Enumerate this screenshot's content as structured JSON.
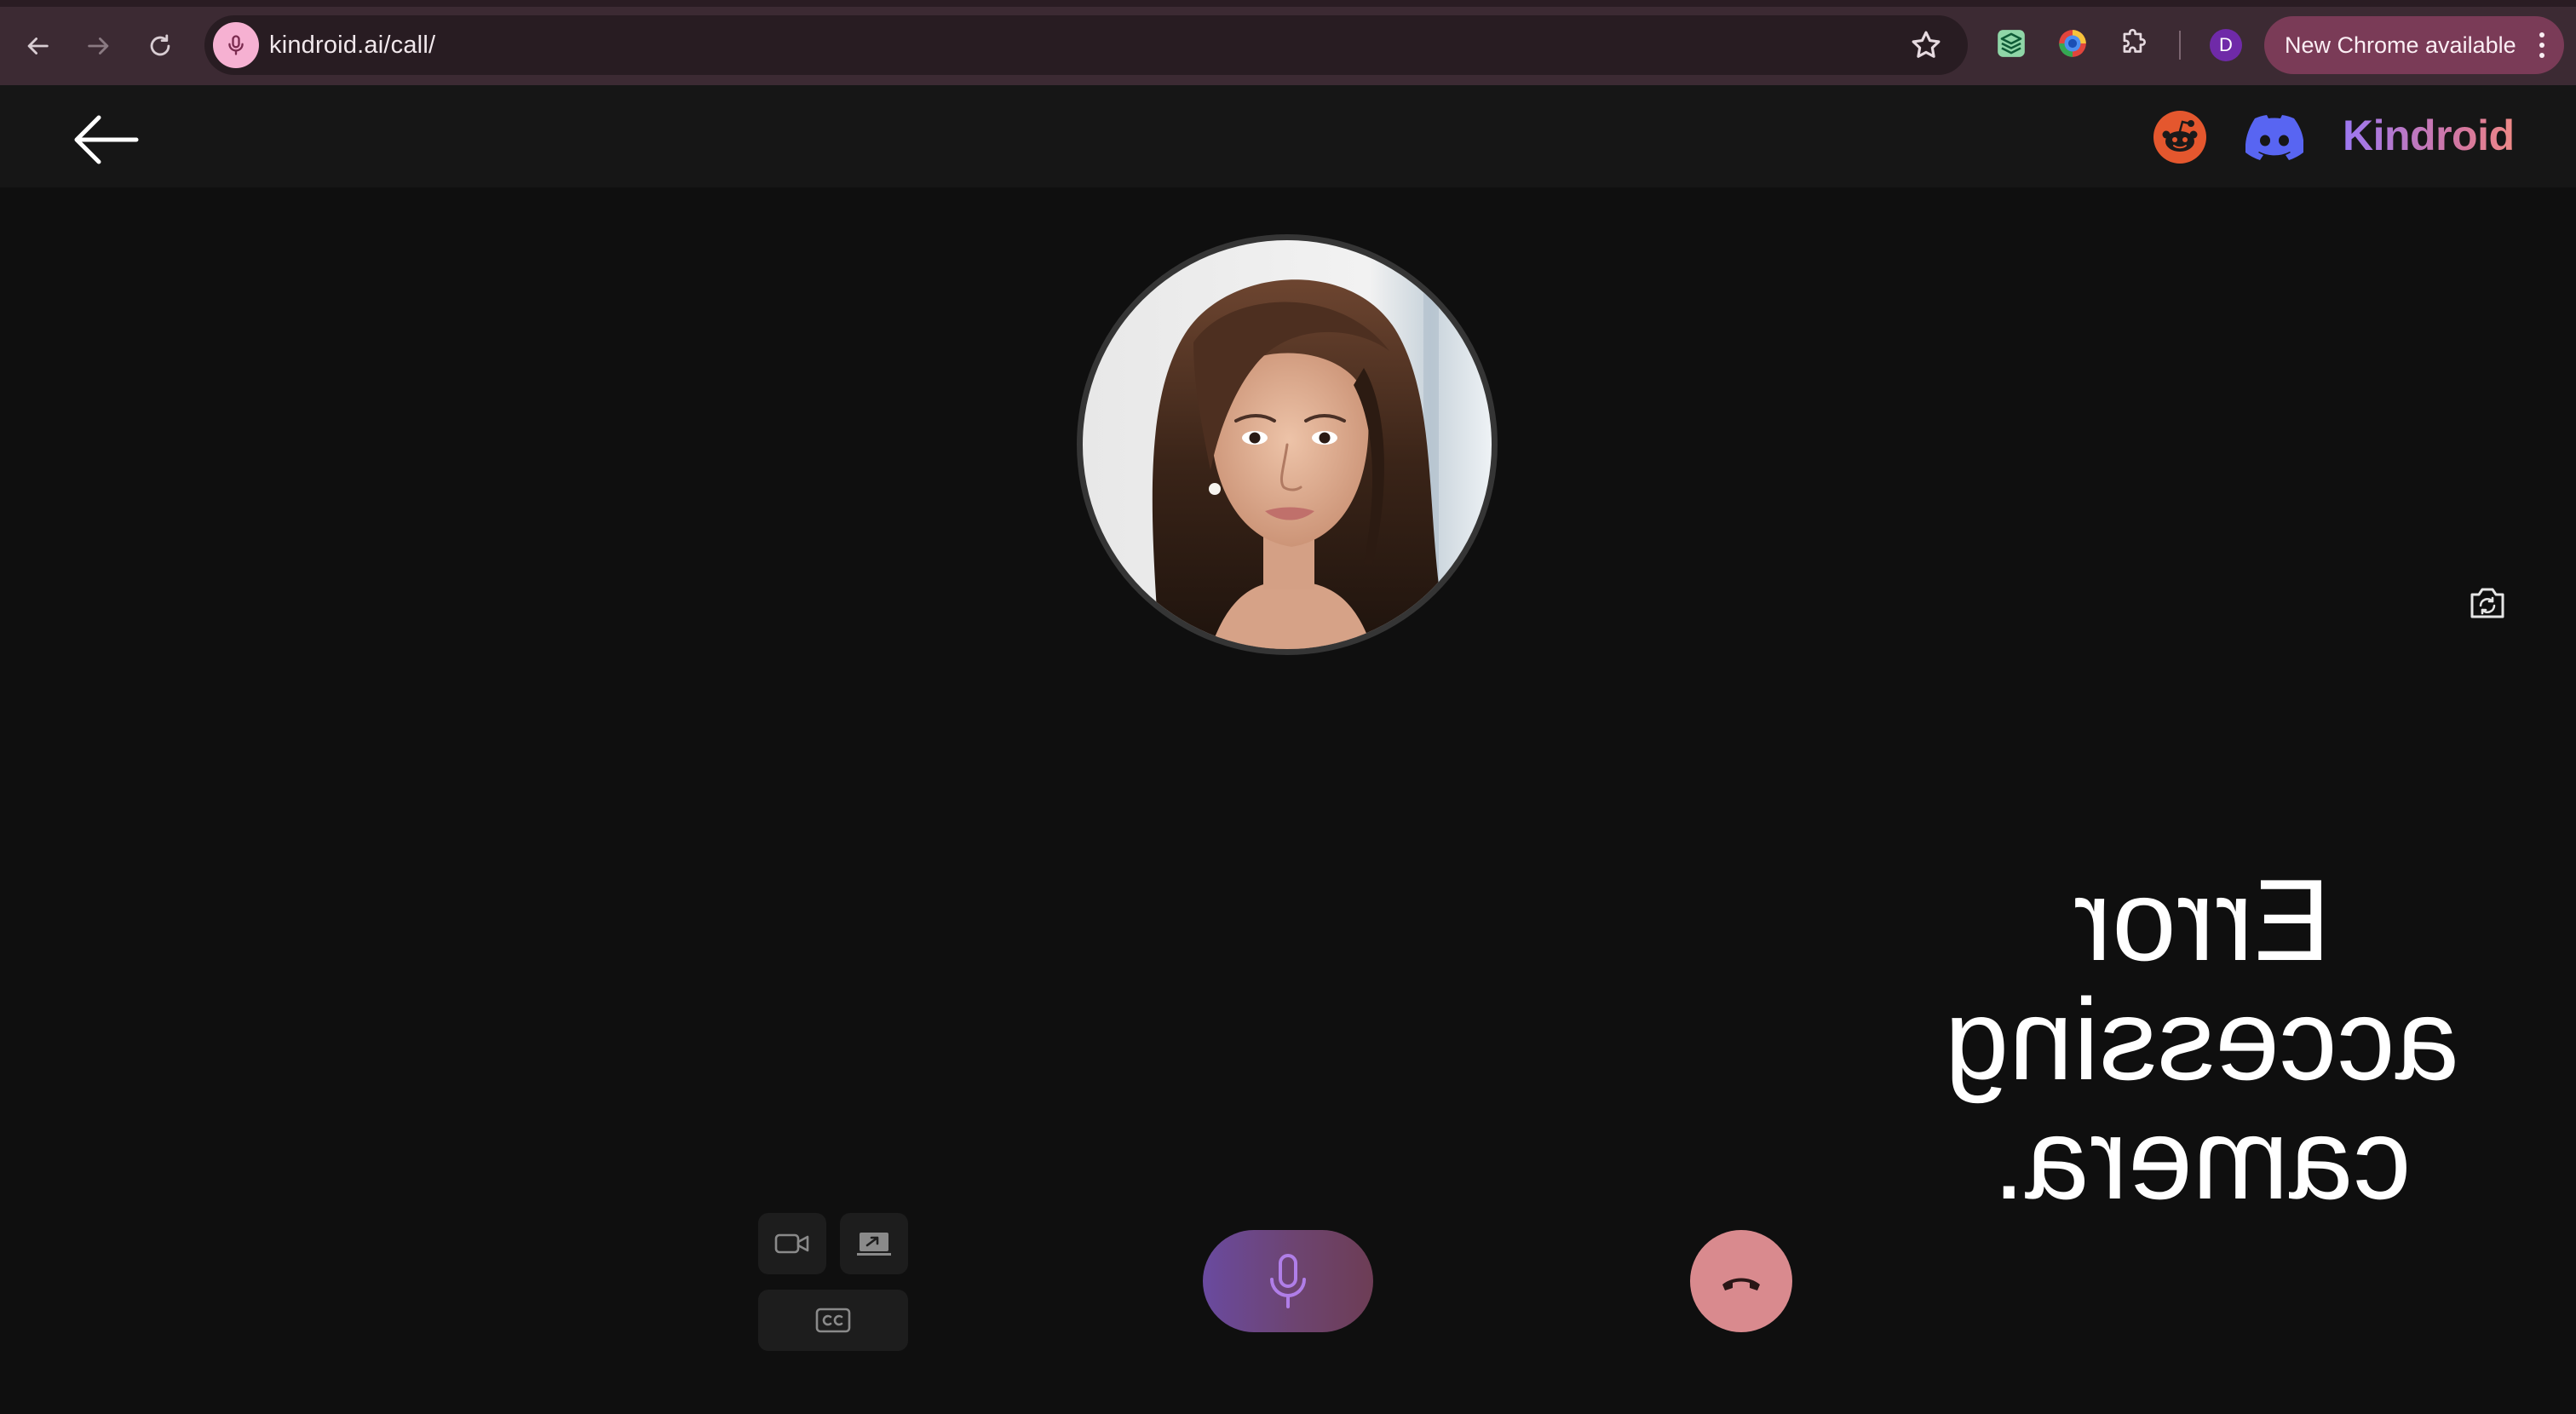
{
  "browser": {
    "url": "kindroid.ai/call/",
    "update_label": "New Chrome available",
    "profile_initial": "D"
  },
  "app": {
    "brand": "Kindroid",
    "error_message": "Error accessing camera."
  },
  "colors": {
    "brand_gradient_start": "#9c78f2",
    "brand_gradient_end": "#ef8a87",
    "mic_button": "#6a4a9f",
    "hangup_button": "#d98a8e",
    "reddit": "#e4572e",
    "discord": "#5865f2"
  },
  "icons": {
    "back": "arrow-left-icon",
    "reddit": "reddit-icon",
    "discord": "discord-icon",
    "flip_camera": "camera-flip-icon",
    "video": "video-camera-icon",
    "screen_share": "screen-share-icon",
    "captions": "closed-captions-icon",
    "mic": "microphone-icon",
    "hangup": "phone-hangup-icon"
  }
}
